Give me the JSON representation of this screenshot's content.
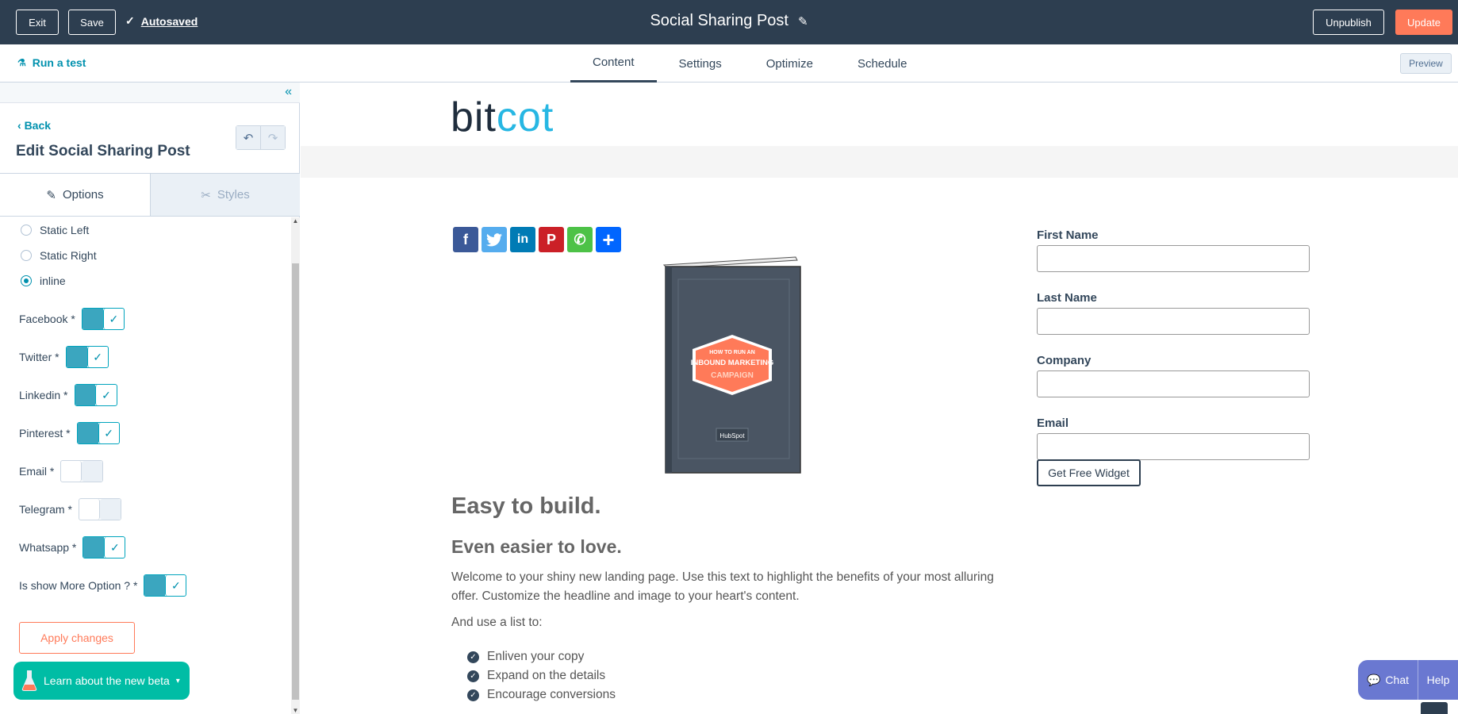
{
  "topbar": {
    "exit_label": "Exit",
    "save_label": "Save",
    "autosaved_label": "Autosaved",
    "title": "Social Sharing Post",
    "unpublish_label": "Unpublish",
    "update_label": "Update"
  },
  "subnav": {
    "run_test_label": "Run a test",
    "tabs": [
      {
        "label": "Content",
        "active": true
      },
      {
        "label": "Settings",
        "active": false
      },
      {
        "label": "Optimize",
        "active": false
      },
      {
        "label": "Schedule",
        "active": false
      }
    ],
    "preview_label": "Preview"
  },
  "sidebar": {
    "back_label": "Back",
    "title": "Edit Social Sharing Post",
    "tabs": [
      {
        "label": "Options",
        "active": true
      },
      {
        "label": "Styles",
        "active": false
      }
    ],
    "position_options": [
      {
        "label": "Static Left",
        "selected": false
      },
      {
        "label": "Static Right",
        "selected": false
      },
      {
        "label": "inline",
        "selected": true
      }
    ],
    "toggles": [
      {
        "label": "Facebook *",
        "on": true
      },
      {
        "label": "Twitter *",
        "on": true
      },
      {
        "label": "Linkedin *",
        "on": true
      },
      {
        "label": "Pinterest *",
        "on": true
      },
      {
        "label": "Email *",
        "on": false
      },
      {
        "label": "Telegram *",
        "on": false
      },
      {
        "label": "Whatsapp *",
        "on": true
      },
      {
        "label": "Is show More Option ? *",
        "on": true
      }
    ],
    "apply_label": "Apply changes",
    "beta_label": "Learn about the new beta"
  },
  "preview": {
    "logo_part1": "bit",
    "logo_part2": "cot",
    "share_icons": [
      {
        "name": "facebook-icon",
        "glyph": "f",
        "color": "#3b5998"
      },
      {
        "name": "twitter-icon",
        "glyph": "t",
        "color": "#55acee"
      },
      {
        "name": "linkedin-icon",
        "glyph": "in",
        "color": "#007bb5"
      },
      {
        "name": "pinterest-icon",
        "glyph": "P",
        "color": "#cb2027"
      },
      {
        "name": "whatsapp-icon",
        "glyph": "✆",
        "color": "#4dc247"
      },
      {
        "name": "more-share-icon",
        "glyph": "+",
        "color": "#0166ff"
      }
    ],
    "book_line1": "HOW TO RUN AN",
    "book_line2": "INBOUND MARKETING",
    "book_line3": "CAMPAIGN",
    "book_brand": "HubSpot",
    "heading1": "Easy to build.",
    "heading2": "Even easier to love.",
    "paragraph": "Welcome to your shiny new landing page. Use this text to highlight the benefits of your most alluring offer. Customize the headline and image to your heart's content.",
    "list_intro": "And use a list to:",
    "list_items": [
      "Enliven your copy",
      "Expand on the details",
      "Encourage conversions"
    ],
    "form": {
      "fields": [
        {
          "label": "First Name",
          "value": ""
        },
        {
          "label": "Last Name",
          "value": ""
        },
        {
          "label": "Company",
          "value": ""
        },
        {
          "label": "Email",
          "value": ""
        }
      ],
      "submit_label": "Get Free Widget"
    }
  },
  "chat": {
    "chat_label": "Chat",
    "help_label": "Help"
  },
  "colors": {
    "topbar": "#2d3e50",
    "accent": "#0091ae",
    "update": "#ff7a59",
    "toggle_on": "#3ba6bf"
  }
}
